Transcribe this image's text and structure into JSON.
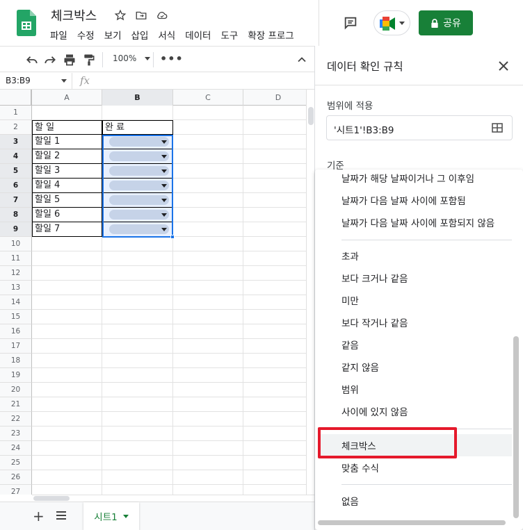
{
  "header": {
    "doc_title": "체크박스",
    "menu": [
      "파일",
      "수정",
      "보기",
      "삽입",
      "서식",
      "데이터",
      "도구",
      "확장 프로그"
    ],
    "share_label": "공유"
  },
  "toolbar": {
    "zoom": "100%"
  },
  "formula_bar": {
    "name_box": "B3:B9",
    "fx": "fx"
  },
  "grid": {
    "columns": [
      "A",
      "B",
      "C",
      "D"
    ],
    "rows": [
      "1",
      "2",
      "3",
      "4",
      "5",
      "6",
      "7",
      "8",
      "9",
      "10",
      "11",
      "12",
      "13",
      "14",
      "15",
      "16",
      "17",
      "18",
      "19",
      "20",
      "21",
      "22",
      "23",
      "24",
      "25",
      "26",
      "27"
    ],
    "cells": {
      "a2": "할 일",
      "b2": "완 료",
      "a3": "할일 1",
      "a4": "할일 2",
      "a5": "할일 3",
      "a6": "할일 4",
      "a7": "할일 5",
      "a8": "할일 6",
      "a9": "할일 7"
    }
  },
  "sheet_tabs": {
    "active": "시트1"
  },
  "panel": {
    "title": "데이터 확인 규칙",
    "range_label": "범위에 적용",
    "range_value": "'시트1'!B3:B9",
    "criteria_label": "기준",
    "options": [
      "날짜가 해당 날짜이거나 그 이후임",
      "날짜가 다음 날짜 사이에 포함됨",
      "날짜가 다음 날짜 사이에 포함되지 않음",
      "초과",
      "보다 크거나 같음",
      "미만",
      "보다 작거나 같음",
      "같음",
      "같지 않음",
      "범위",
      "사이에 있지 않음",
      "체크박스",
      "맞춤 수식",
      "없음"
    ],
    "highlighted_option": "체크박스"
  },
  "colors": {
    "accent": "#1a73e8",
    "brand_green": "#188038",
    "highlight_red": "#e5192b"
  }
}
